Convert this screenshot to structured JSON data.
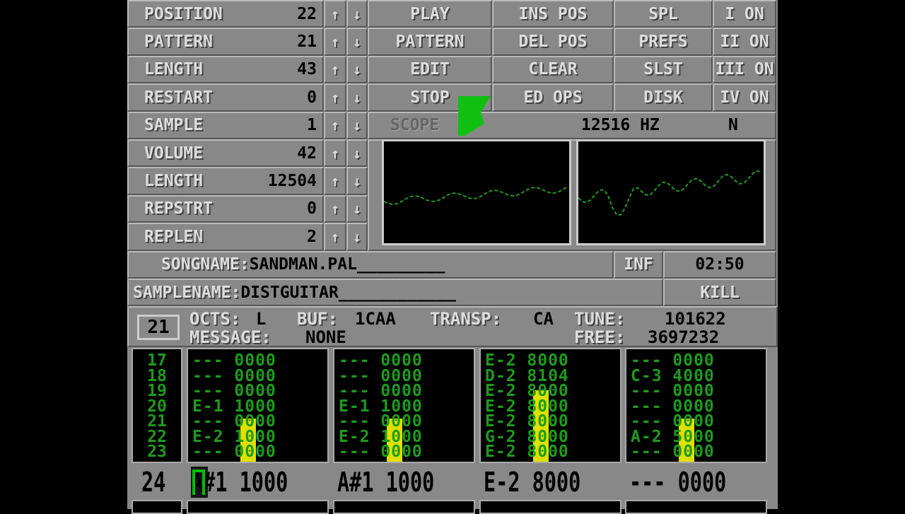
{
  "song": {
    "rows": [
      {
        "label": "POSITION",
        "value": "22"
      },
      {
        "label": "PATTERN",
        "value": "21"
      },
      {
        "label": "LENGTH",
        "value": "43"
      },
      {
        "label": "RESTART",
        "value": "0"
      }
    ]
  },
  "sample": {
    "label": "SAMPLE",
    "value": "1"
  },
  "sample_params": [
    {
      "label": "VOLUME",
      "value": "42"
    },
    {
      "label": "LENGTH",
      "value": "12504"
    },
    {
      "label": "REPSTRT",
      "value": "0"
    },
    {
      "label": "REPLEN",
      "value": "2"
    }
  ],
  "arrows": {
    "up": "↑",
    "down": "↓"
  },
  "buttons": [
    [
      "PLAY",
      "INS POS",
      "SPL",
      "I ON"
    ],
    [
      "PATTERN",
      "DEL POS",
      "PREFS",
      "II ON"
    ],
    [
      "EDIT",
      "CLEAR",
      "SLST",
      "III ON"
    ],
    [
      "STOP",
      "ED OPS",
      "DISK",
      "IV ON"
    ]
  ],
  "scope": {
    "label": "SCOPE",
    "freq": "12516 HZ",
    "mode": "N"
  },
  "songname": {
    "label": "SONGNAME:",
    "value": "SANDMAN.PAL_________"
  },
  "inf": "INF",
  "time": "02:50",
  "samplename": {
    "label": "SAMPLENAME:",
    "value": "DISTGUITAR____________"
  },
  "kill": "KILL",
  "info": {
    "pattern": "21",
    "octs_label": "OCTS:",
    "octs": "L",
    "buf_label": "BUF:",
    "buf": "1CAA",
    "transp_label": "TRANSP:",
    "transp": "CA",
    "tune_label": "TUNE:",
    "tune": "101622",
    "message_label": "MESSAGE:",
    "message": "NONE",
    "free_label": "FREE:",
    "free": "3697232"
  },
  "pattern": {
    "row_numbers": [
      "17",
      "18",
      "19",
      "20",
      "21",
      "22",
      "23"
    ],
    "channels": [
      {
        "rows": [
          "--- 0000",
          "--- 0000",
          "--- 0000",
          "E-1 1000",
          "--- 0000",
          "E-2 1000",
          "--- 0000"
        ],
        "vu": 0.38
      },
      {
        "rows": [
          "--- 0000",
          "--- 0000",
          "--- 0000",
          "E-1 1000",
          "--- 0000",
          "E-2 1000",
          "--- 0000"
        ],
        "vu": 0.38
      },
      {
        "rows": [
          "E-2 8000",
          "D-2 8104",
          "E-2 8000",
          "E-2 8000",
          "E-2 8000",
          "G-2 8000",
          "E-2 8000"
        ],
        "vu": 0.63
      },
      {
        "rows": [
          "--- 0000",
          "C-3 4000",
          "--- 0000",
          "--- 0000",
          "--- 0000",
          "A-2 5000",
          "--- 0000"
        ],
        "vu": 0.38
      }
    ],
    "current": {
      "row": "24",
      "cells": [
        "A#1 1000",
        "A#1 1000",
        "E-2 8000",
        "--- 0000"
      ]
    }
  },
  "colors": {
    "background": "#888888",
    "pattern_text": "#1c9c1c",
    "vu": "#e0e000",
    "cursor": "#00c000"
  }
}
